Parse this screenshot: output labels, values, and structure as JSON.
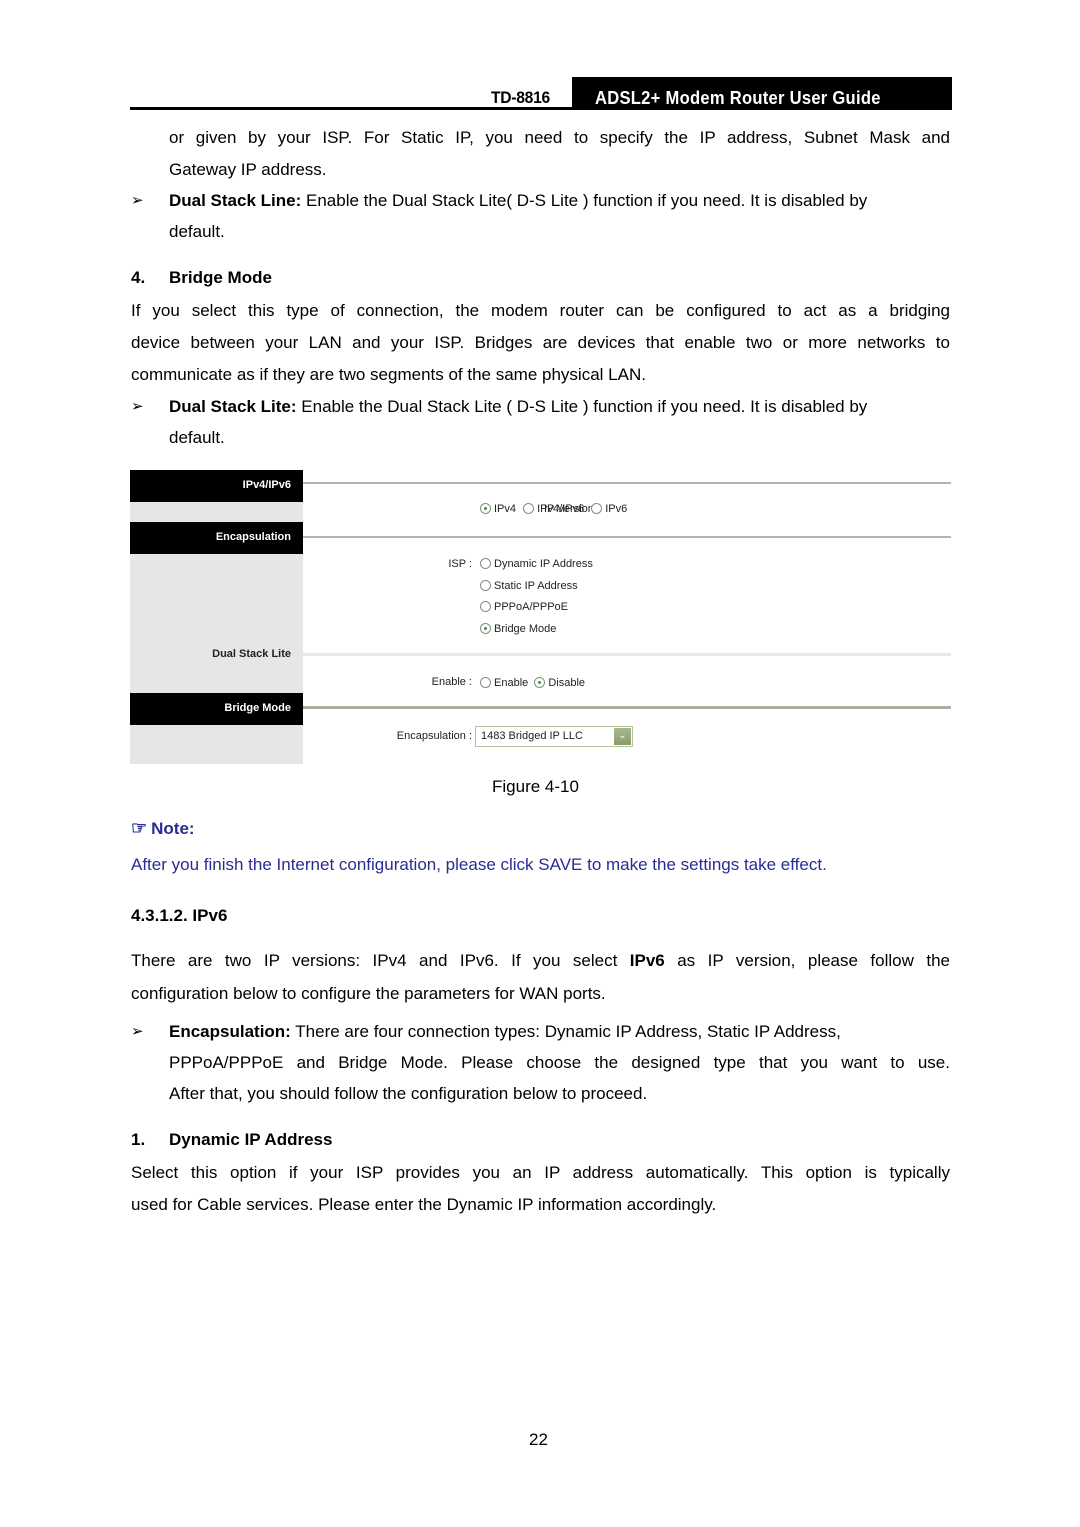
{
  "header": {
    "model": "TD-8816",
    "title": "ADSL2+ Modem Router User Guide"
  },
  "paragraphs": {
    "cont_line1": "or given by your ISP. For Static IP, you need to specify the IP address, Subnet Mask and",
    "cont_line2": "Gateway IP address.",
    "bullet_dsl_label": "Dual Stack Line:",
    "bullet_dsl_line1": " Enable the Dual Stack Lite( D-S Lite ) function if you need. It is disabled by",
    "bullet_dsl_line2": "default.",
    "bridge_heading_num": "4.",
    "bridge_heading": "Bridge Mode",
    "bridge_p_line1": "If you select this type of connection, the modem router can be configured to act as a bridging",
    "bridge_p_line2": "device between your LAN and your ISP. Bridges are devices that enable two or more networks to",
    "bridge_p_line3": "communicate as if they are two segments of the same physical LAN.",
    "bullet_dslite_label": "Dual Stack Lite:",
    "bullet_dslite_line1": " Enable the Dual Stack Lite ( D-S Lite ) function if you need. It is disabled by",
    "bullet_dslite_line2": "default.",
    "bullet_glyph": "➢"
  },
  "figure": {
    "tabs": {
      "ipver": "IPv4/IPv6",
      "encap": "Encapsulation",
      "dslite": "Dual Stack Lite",
      "bridge": "Bridge Mode"
    },
    "ip_version": {
      "label": "IP Version :",
      "options": [
        "IPv4",
        "IPv4/IPv6",
        "IPv6"
      ],
      "selected": "IPv4"
    },
    "isp": {
      "label": "ISP :",
      "options": [
        "Dynamic IP Address",
        "Static IP Address",
        "PPPoA/PPPoE",
        "Bridge Mode"
      ],
      "selected": "Bridge Mode"
    },
    "enable": {
      "label": "Enable :",
      "options": [
        "Enable",
        "Disable"
      ],
      "selected": "Disable"
    },
    "encapsulation": {
      "label": "Encapsulation :",
      "value": "1483 Bridged IP LLC"
    },
    "caption": "Figure 4-10"
  },
  "note": {
    "title": "Note:",
    "body": "After you finish the Internet configuration, please click SAVE to make the settings take effect.",
    "color": "#2b2b96"
  },
  "ipv6": {
    "heading": "4.3.1.2.  IPv6",
    "p_line1_a": "There are two IP versions: IPv4 and IPv6. If you select ",
    "p_line1_bold": "IPv6",
    "p_line1_b": " as IP version, please follow the",
    "p_line2": "configuration below to configure the parameters for WAN ports.",
    "bullet_encap_label": "Encapsulation:",
    "bullet_encap_line1": " There are four connection types: Dynamic IP Address, Static IP Address,",
    "bullet_encap_line2": "PPPoA/PPPoE and Bridge Mode. Please choose the designed type that you want to use.",
    "bullet_encap_line3": "After that, you should follow the configuration below to proceed.",
    "dyn_heading_num": "1.",
    "dyn_heading": "Dynamic IP Address",
    "dyn_p_line1": "Select this option if your ISP provides you an IP address automatically. This option is typically",
    "dyn_p_line2": "used for Cable services. Please enter the Dynamic IP information accordingly."
  },
  "page_number": "22"
}
